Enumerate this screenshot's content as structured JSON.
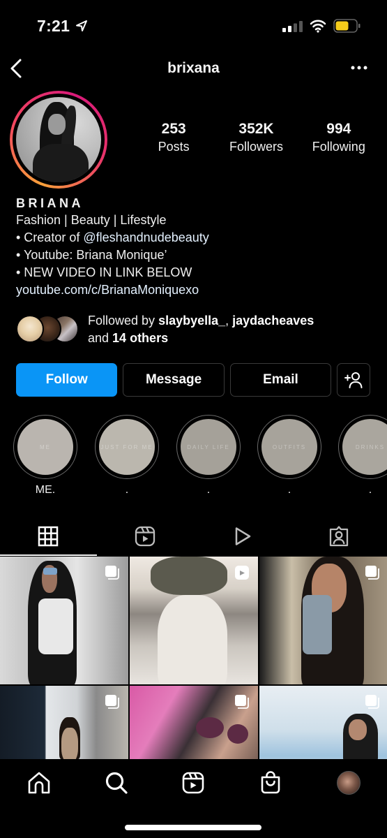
{
  "status_bar": {
    "time": "7:21",
    "icons": [
      "location-arrow-icon",
      "signal-icon",
      "wifi-icon",
      "battery-icon"
    ],
    "battery_color": "#f5cc1b"
  },
  "header": {
    "title": "brixana",
    "back_icon": "chevron-left-icon",
    "more_icon": "more-horizontal-icon"
  },
  "profile": {
    "stats": [
      {
        "value": "253",
        "label": "Posts"
      },
      {
        "value": "352K",
        "label": "Followers"
      },
      {
        "value": "994",
        "label": "Following"
      }
    ],
    "name": "BRIANA",
    "bio": {
      "line1": "Fashion | Beauty | Lifestyle",
      "line2_prefix": "• Creator of ",
      "line2_mention": "@fleshandnudebeauty",
      "line3": "• Youtube: Briana Monique’",
      "line4": "• NEW VIDEO IN LINK BELOW",
      "link": "youtube.com/c/BrianaMoniquexo"
    },
    "followed_by": {
      "prefix": "Followed by ",
      "user1": "slaybyella_",
      "separator": ", ",
      "user2": "jaydacheaves",
      "and": "and ",
      "others": "14 others"
    }
  },
  "actions": {
    "follow": "Follow",
    "message": "Message",
    "email": "Email",
    "add_user_icon": "add-user-icon",
    "follow_color": "#0a95f6"
  },
  "highlights": [
    {
      "label": "ME.",
      "cover_text": "ME",
      "cover_color": "#bab5af"
    },
    {
      "label": ".",
      "cover_text": "JUST FOR ME",
      "cover_color": "#bbb7ae"
    },
    {
      "label": ".",
      "cover_text": "DAILY LIFE",
      "cover_color": "#a5a199"
    },
    {
      "label": ".",
      "cover_text": "OUTFITS",
      "cover_color": "#a7a39b"
    },
    {
      "label": ".",
      "cover_text": "DRINKS",
      "cover_color": "#aaa69e"
    }
  ],
  "tabs": [
    {
      "name": "grid",
      "icon": "grid-icon",
      "active": true
    },
    {
      "name": "reels",
      "icon": "reels-icon",
      "active": false
    },
    {
      "name": "videos",
      "icon": "play-icon",
      "active": false
    },
    {
      "name": "tagged",
      "icon": "tagged-person-icon",
      "active": false
    }
  ],
  "posts": [
    {
      "type": "carousel",
      "badge_icon": "carousel-icon"
    },
    {
      "type": "reel",
      "badge_icon": "reel-icon"
    },
    {
      "type": "carousel",
      "badge_icon": "carousel-icon"
    },
    {
      "type": "carousel",
      "badge_icon": "carousel-icon"
    },
    {
      "type": "carousel",
      "badge_icon": "carousel-icon"
    },
    {
      "type": "carousel",
      "badge_icon": "carousel-icon"
    }
  ],
  "bottom_nav": [
    {
      "name": "home",
      "icon": "home-icon"
    },
    {
      "name": "search",
      "icon": "search-icon"
    },
    {
      "name": "reels",
      "icon": "reels-icon"
    },
    {
      "name": "shop",
      "icon": "shopping-bag-icon"
    },
    {
      "name": "profile",
      "icon": "profile-avatar"
    }
  ]
}
